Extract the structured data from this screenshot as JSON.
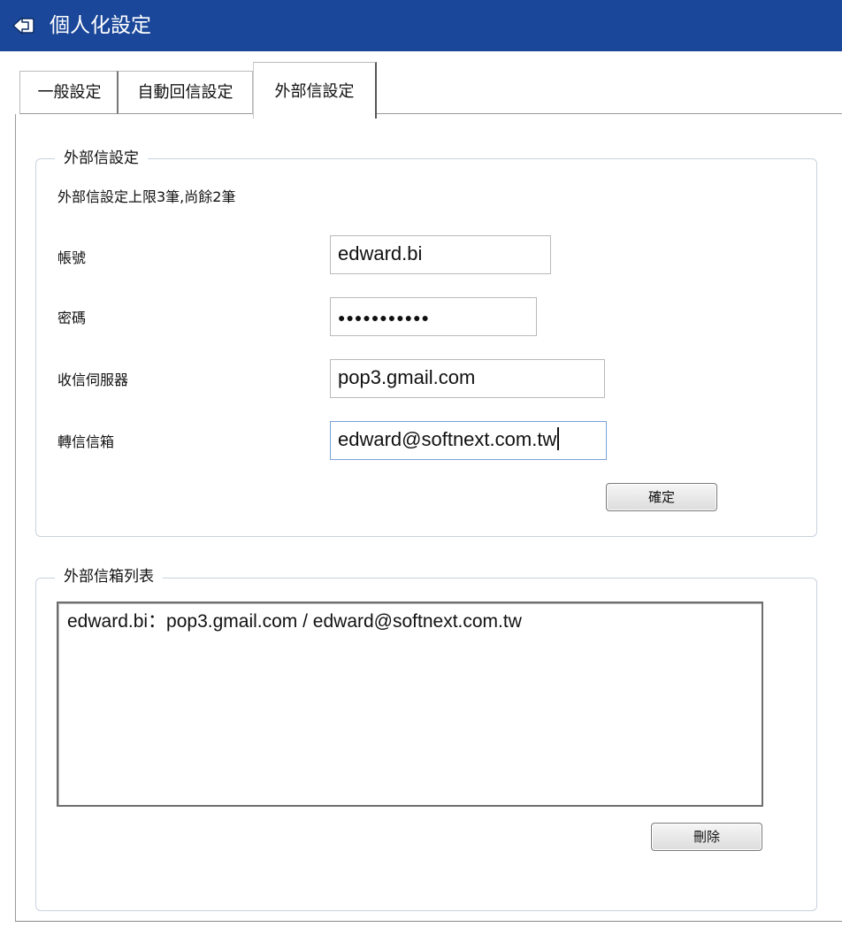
{
  "window": {
    "title": "個人化設定",
    "back_icon": "back-arrow-icon",
    "accent_color": "#1a4799"
  },
  "tabs": [
    {
      "label": "一般設定",
      "active": false
    },
    {
      "label": "自動回信設定",
      "active": false
    },
    {
      "label": "外部信設定",
      "active": true
    }
  ],
  "external_settings": {
    "legend": "外部信設定",
    "limit_text": "外部信設定上限3筆,尚餘2筆",
    "fields": {
      "account": {
        "label": "帳號",
        "value": "edward.bi"
      },
      "password": {
        "label": "密碼",
        "value": "●●●●●●●●●●●"
      },
      "server": {
        "label": "收信伺服器",
        "value": "pop3.gmail.com"
      },
      "forward": {
        "label": "轉信信箱",
        "value": "edward@softnext.com.tw"
      }
    },
    "confirm_label": "確定"
  },
  "mailbox_list": {
    "legend": "外部信箱列表",
    "items": [
      "edward.bi：pop3.gmail.com / edward@softnext.com.tw"
    ],
    "delete_label": "刪除"
  }
}
